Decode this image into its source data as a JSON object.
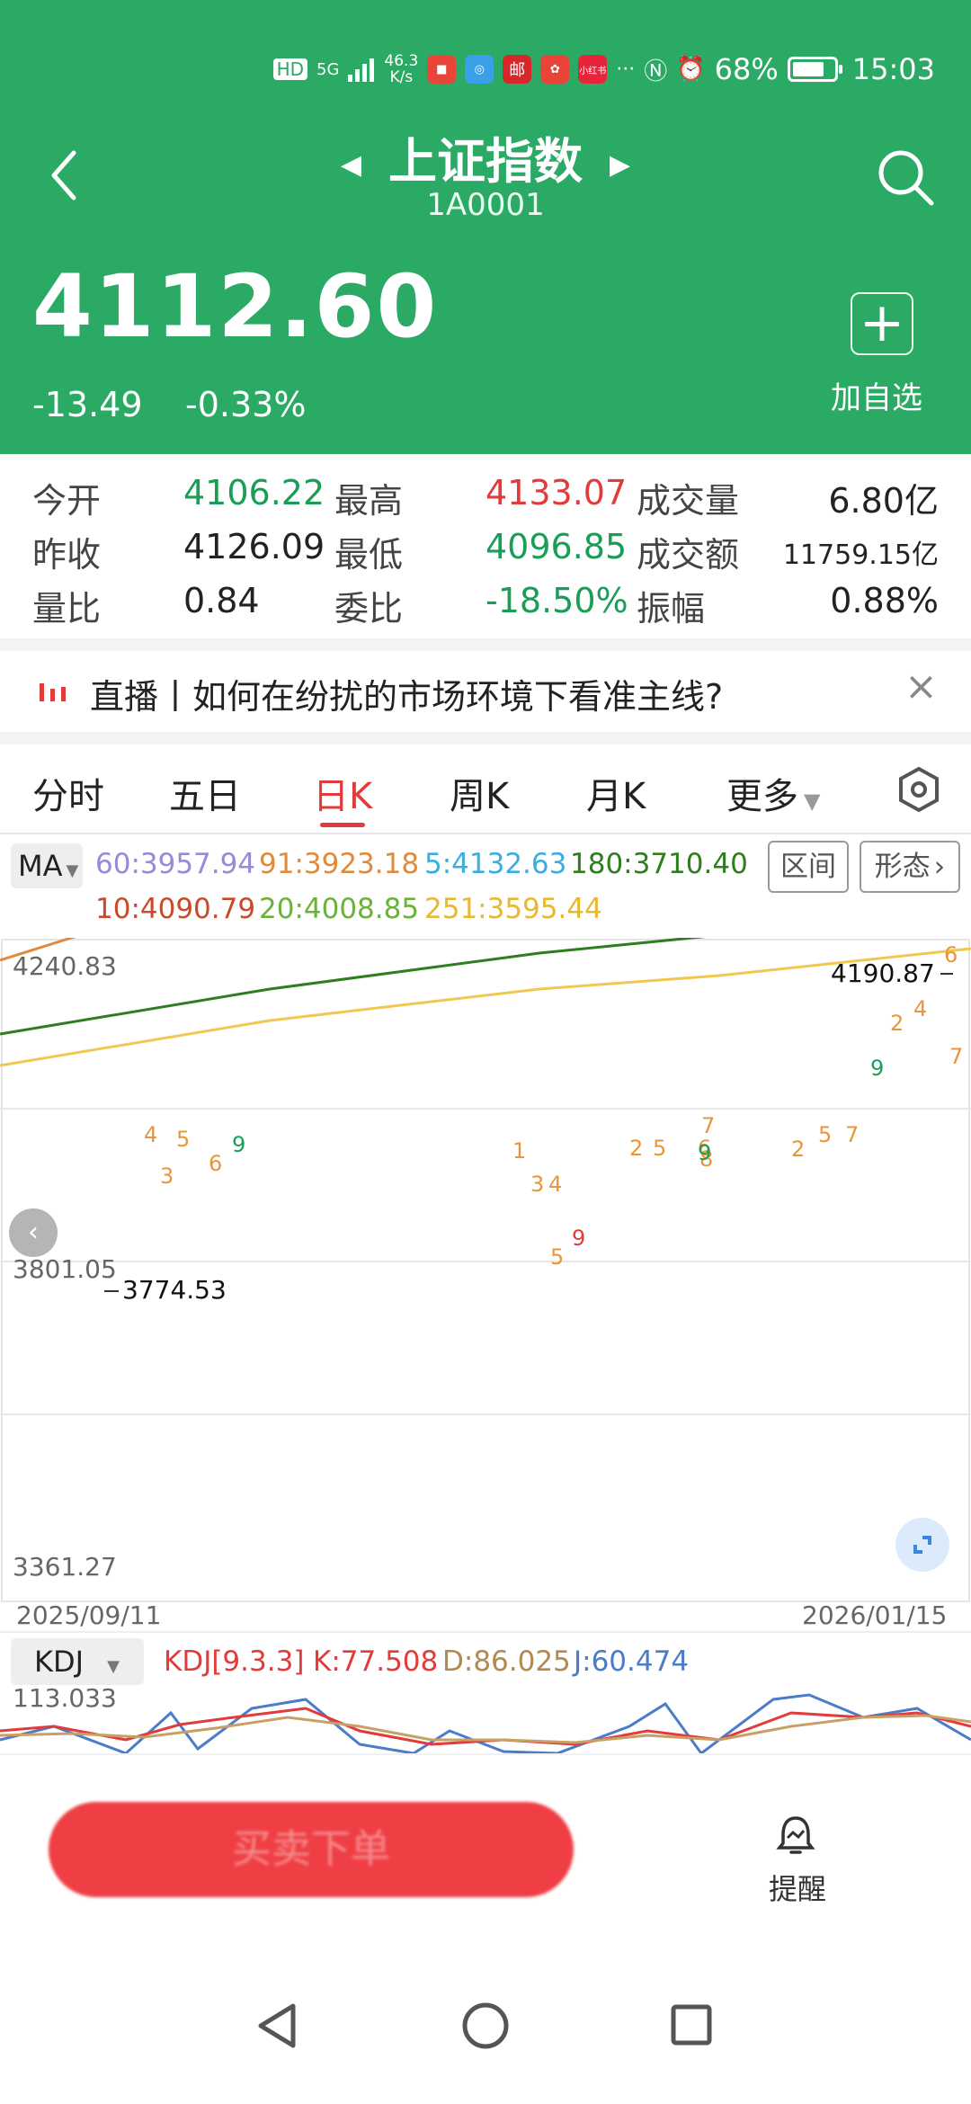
{
  "status_bar": {
    "hd": "HD",
    "signal": "5G",
    "net_speed_value": "46.3",
    "net_speed_unit": "K/s",
    "app_icons": [
      "huawei",
      "mail",
      "邮",
      "dianping",
      "小红书"
    ],
    "battery": "68%",
    "battery_level": 0.68,
    "time": "15:03"
  },
  "header": {
    "title": "上证指数",
    "code": "1A0001",
    "price": "4112.60",
    "change": "-13.49",
    "change_pct": "-0.33%",
    "add_label": "加自选",
    "add_symbol": "+",
    "bg_color": "#2aaa64"
  },
  "stats": [
    {
      "label": "今开",
      "value": "4106.22",
      "color": "green"
    },
    {
      "label": "最高",
      "value": "4133.07",
      "color": "red"
    },
    {
      "label": "成交量",
      "value": "6.80亿",
      "color": "black"
    },
    {
      "label": "昨收",
      "value": "4126.09",
      "color": "black"
    },
    {
      "label": "最低",
      "value": "4096.85",
      "color": "green"
    },
    {
      "label": "成交额",
      "value": "11759.15亿",
      "color": "black"
    },
    {
      "label": "量比",
      "value": "0.84",
      "color": "black"
    },
    {
      "label": "委比",
      "value": "-18.50%",
      "color": "green"
    },
    {
      "label": "振幅",
      "value": "0.88%",
      "color": "black"
    }
  ],
  "live": {
    "text": "直播丨如何在纷扰的市场环境下看准主线?",
    "close": "×"
  },
  "tabs": [
    "分时",
    "五日",
    "日K",
    "周K",
    "月K",
    "更多"
  ],
  "active_tab": "日K",
  "ma": {
    "selector": "MA",
    "items": [
      {
        "label": "60:3957.94",
        "color": "#9b88d8"
      },
      {
        "label": "91:3923.18",
        "color": "#e08a3c"
      },
      {
        "label": "5:4132.63",
        "color": "#3aaee0"
      },
      {
        "label": "180:3710.40",
        "color": "#2e7d1e"
      },
      {
        "label": "10:4090.79",
        "color": "#c94a2a"
      },
      {
        "label": "20:4008.85",
        "color": "#6bb23a"
      },
      {
        "label": "251:3595.44",
        "color": "#f0c850"
      }
    ],
    "range_btn": "区间",
    "pattern_btn": "形态"
  },
  "chart_data": {
    "type": "candlestick",
    "x_start": "2025/09/11",
    "x_end": "2026/01/15",
    "y_top_label": "4240.83",
    "y_mid_label": "3801.05",
    "y_bottom_label": "3361.27",
    "ylim": [
      3361.27,
      4240.83
    ],
    "high_marker": "4190.87",
    "low_marker": "3774.53",
    "up_color": "#e23b3b",
    "down_color": "#1a9e57",
    "grid": true
  },
  "kdj": {
    "selector": "KDJ",
    "params": "KDJ[9.3.3]",
    "k": "K:77.508",
    "d": "D:86.025",
    "j": "J:60.474",
    "top_label": "113.033"
  },
  "bottom_bar": {
    "trade_label": "买卖下单",
    "remind_label": "提醒"
  }
}
